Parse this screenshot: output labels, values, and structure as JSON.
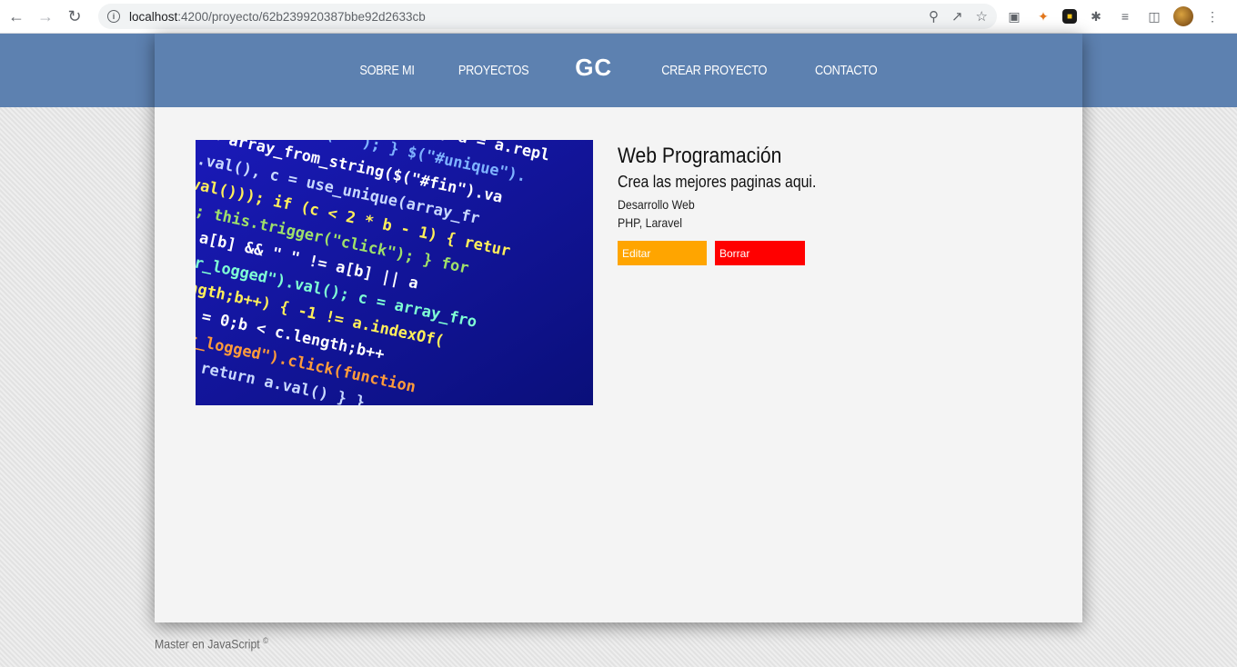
{
  "browser": {
    "url_host": "localhost",
    "url_path": ":4200/proyecto/62b239920387bbe92d2633cb"
  },
  "nav": {
    "items": [
      "SOBRE MI",
      "PROYECTOS"
    ],
    "logo": "GC",
    "items_right": [
      "CREAR PROYECTO",
      "CONTACTO"
    ]
  },
  "project": {
    "title": "Web Programación",
    "description": "Crea las mejores paginas aqui.",
    "category": "Desarrollo Web",
    "langs": "PHP, Laravel",
    "edit_label": "Editar",
    "delete_label": "Borrar"
  },
  "footer": {
    "text": "Master en JavaScript",
    "symbol": "©"
  },
  "colors": {
    "header": "#5d81b0",
    "edit": "#ffa500",
    "delete": "#ff0000"
  }
}
